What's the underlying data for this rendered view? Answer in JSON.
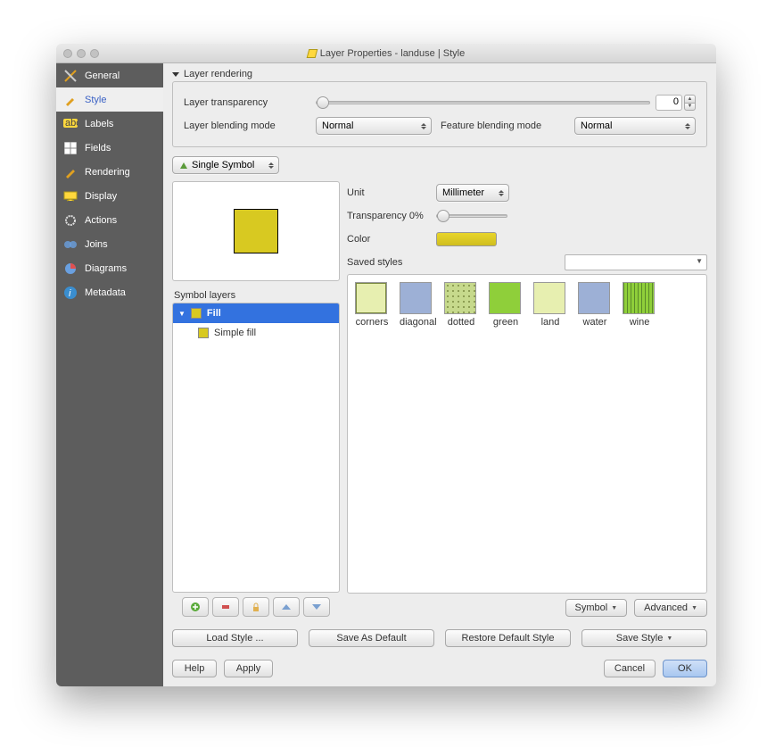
{
  "title": "Layer Properties - landuse | Style",
  "sidebar": {
    "items": [
      {
        "label": "General"
      },
      {
        "label": "Style"
      },
      {
        "label": "Labels"
      },
      {
        "label": "Fields"
      },
      {
        "label": "Rendering"
      },
      {
        "label": "Display"
      },
      {
        "label": "Actions"
      },
      {
        "label": "Joins"
      },
      {
        "label": "Diagrams"
      },
      {
        "label": "Metadata"
      }
    ]
  },
  "render": {
    "section": "Layer rendering",
    "transparency_label": "Layer transparency",
    "transparency_value": "0",
    "layer_blend_label": "Layer blending mode",
    "layer_blend_value": "Normal",
    "feature_blend_label": "Feature blending mode",
    "feature_blend_value": "Normal"
  },
  "symbol_selector": "Single Symbol",
  "symbol_layers_label": "Symbol layers",
  "tree": {
    "parent": "Fill",
    "child": "Simple fill"
  },
  "opts": {
    "unit_label": "Unit",
    "unit_value": "Millimeter",
    "transp_label": "Transparency 0%",
    "color_label": "Color",
    "saved_label": "Saved styles"
  },
  "styles": [
    {
      "label": "corners",
      "bg": "#e7efb0",
      "pattern": "corners"
    },
    {
      "label": "diagonal",
      "bg": "#9db0d6",
      "pattern": "solid"
    },
    {
      "label": "dotted",
      "bg": "#c6d98c",
      "pattern": "dotted"
    },
    {
      "label": "green",
      "bg": "#8fcf3a",
      "pattern": "solid"
    },
    {
      "label": "land",
      "bg": "#e7efb0",
      "pattern": "solid"
    },
    {
      "label": "water",
      "bg": "#9db0d6",
      "pattern": "solid"
    },
    {
      "label": "wine",
      "bg": "#8fcf3a",
      "pattern": "hatch"
    }
  ],
  "buttons": {
    "symbol": "Symbol",
    "advanced": "Advanced",
    "load": "Load Style ...",
    "save_default": "Save As Default",
    "restore": "Restore Default Style",
    "save_style": "Save Style",
    "help": "Help",
    "apply": "Apply",
    "cancel": "Cancel",
    "ok": "OK"
  }
}
